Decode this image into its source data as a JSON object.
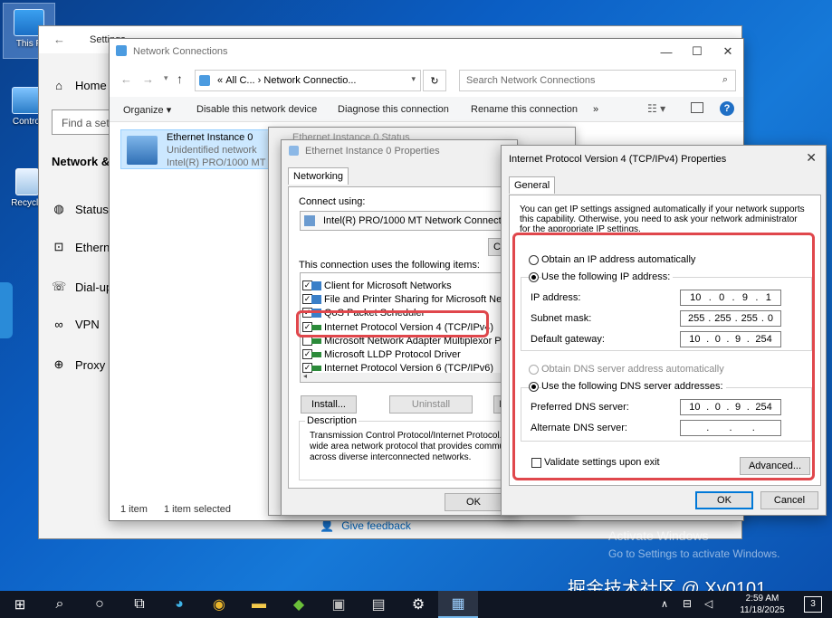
{
  "desktop": {
    "icons": [
      {
        "label": "This P",
        "icon": "computer-icon"
      },
      {
        "label": "Control",
        "icon": "control-panel-icon"
      },
      {
        "label": "Recycle",
        "icon": "recycle-bin-icon"
      }
    ]
  },
  "settings": {
    "title": "Settings",
    "home": "Home",
    "find_placeholder": "Find a set",
    "section": "Network &",
    "items": [
      "Status",
      "Ethern",
      "Dial-up",
      "VPN",
      "Proxy"
    ],
    "feedback": "Give feedback"
  },
  "netconn": {
    "title": "Network Connections",
    "breadcrumb_prefix": "«",
    "breadcrumb_all": "All C...",
    "breadcrumb_sep": "›",
    "breadcrumb_current": "Network Connectio...",
    "search_placeholder": "Search Network Connections",
    "toolbar": [
      "Organize ▾",
      "Disable this network device",
      "Diagnose this connection",
      "Rename this connection",
      "»"
    ],
    "adapter": {
      "name": "Ethernet Instance 0",
      "status": "Unidentified network",
      "device": "Intel(R) PRO/1000 MT N"
    },
    "status_count": "1 item",
    "status_selected": "1 item selected"
  },
  "status_window": {
    "title": "Ethernet Instance 0 Status"
  },
  "eth_props": {
    "title": "Ethernet Instance 0 Properties",
    "tab": "Networking",
    "connect_using": "Connect using:",
    "adapter": "Intel(R) PRO/1000 MT Network Connection",
    "configure_btn": "C",
    "items_label": "This connection uses the following items:",
    "items": [
      {
        "label": "Client for Microsoft Networks",
        "checked": true
      },
      {
        "label": "File and Printer Sharing for Microsoft Networ",
        "checked": true
      },
      {
        "label": "QoS Packet Scheduler",
        "checked": true
      },
      {
        "label": "Internet Protocol Version 4 (TCP/IPv4)",
        "checked": true
      },
      {
        "label": "Microsoft Network Adapter Multiplexor Proto",
        "checked": false
      },
      {
        "label": "Microsoft LLDP Protocol Driver",
        "checked": true
      },
      {
        "label": "Internet Protocol Version 6 (TCP/IPv6)",
        "checked": true
      }
    ],
    "install_btn": "Install...",
    "uninstall_btn": "Uninstall",
    "properties_btn": "P",
    "description_label": "Description",
    "description": [
      "Transmission Control Protocol/Internet Protocol. Th",
      "wide area network protocol that provides communi",
      "across diverse interconnected networks."
    ],
    "ok_btn": "OK"
  },
  "ipv4": {
    "title": "Internet Protocol Version 4 (TCP/IPv4) Properties",
    "tab": "General",
    "intro": [
      "You can get IP settings assigned automatically if your network supports",
      "this capability. Otherwise, you need to ask your network administrator",
      "for the appropriate IP settings."
    ],
    "obtain_ip_auto": "Obtain an IP address automatically",
    "use_following_ip": "Use the following IP address:",
    "ip_label": "IP address:",
    "ip": [
      "10",
      "0",
      "9",
      "1"
    ],
    "subnet_label": "Subnet mask:",
    "subnet": [
      "255",
      "255",
      "255",
      "0"
    ],
    "gateway_label": "Default gateway:",
    "gateway": [
      "10",
      "0",
      "9",
      "254"
    ],
    "obtain_dns_auto": "Obtain DNS server address automatically",
    "use_following_dns": "Use the following DNS server addresses:",
    "preferred_dns_label": "Preferred DNS server:",
    "preferred_dns": [
      "10",
      "0",
      "9",
      "254"
    ],
    "alternate_dns_label": "Alternate DNS server:",
    "alternate_dns": [
      ".",
      ".",
      "."
    ],
    "validate": "Validate settings upon exit",
    "advanced_btn": "Advanced...",
    "ok_btn": "OK",
    "cancel_btn": "Cancel"
  },
  "activate": {
    "line1": "Activate Windows",
    "line2": "Go to Settings to activate Windows."
  },
  "watermark": "掘金技术社区 @ Xy0101",
  "taskbar": {
    "time": "2:59 AM",
    "date": "11/18/2025",
    "notifications": "3"
  },
  "colors": {
    "highlight": "#e0474c",
    "accent": "#0078d7"
  }
}
